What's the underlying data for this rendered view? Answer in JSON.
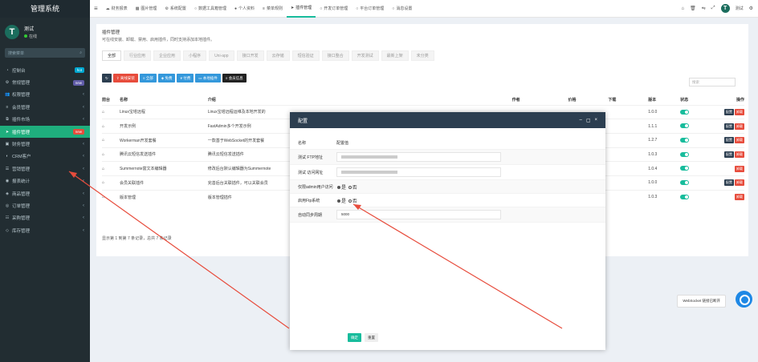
{
  "brand": "管理系统",
  "user": {
    "name": "测试",
    "status": "在线",
    "avatar": "T"
  },
  "search": {
    "placeholder": "搜索菜单",
    "icon": "search-icon"
  },
  "sidebar": [
    {
      "label": "控制台",
      "badge": "hot",
      "badge_color": "#00a7d0",
      "icon": "dashboard-icon"
    },
    {
      "label": "常规管理",
      "badge": "new",
      "badge_color": "#605ca8",
      "icon": "gear-icon"
    },
    {
      "label": "权限管理",
      "icon": "users-icon"
    },
    {
      "label": "会员管理",
      "icon": "user-icon"
    },
    {
      "label": "插件市场",
      "icon": "puzzle-icon"
    },
    {
      "label": "插件管理",
      "badge": "new",
      "badge_color": "#e74c3c",
      "icon": "rocket-icon",
      "active": true
    },
    {
      "label": "财务管理",
      "icon": "money-icon"
    },
    {
      "label": "CRM客户",
      "icon": "crm-icon"
    },
    {
      "label": "营销管理",
      "icon": "bullhorn-icon"
    },
    {
      "label": "报表统计",
      "icon": "chart-icon"
    },
    {
      "label": "商品管理",
      "icon": "box-icon"
    },
    {
      "label": "订单管理",
      "icon": "order-icon"
    },
    {
      "label": "采购管理",
      "icon": "cart-icon"
    },
    {
      "label": "库存管理",
      "icon": "warehouse-icon"
    }
  ],
  "topnav": [
    {
      "label": "财务报表",
      "icon": "cloud-icon"
    },
    {
      "label": "图片管理",
      "icon": "image-icon"
    },
    {
      "label": "系统配置",
      "icon": "cog-icon"
    },
    {
      "label": "数据工具箱管理",
      "icon": "circle-icon"
    },
    {
      "label": "个人资料",
      "icon": "person-icon"
    },
    {
      "label": "菜单规则",
      "icon": "list-icon"
    },
    {
      "label": "插件管理",
      "icon": "rocket-icon",
      "active": true
    },
    {
      "label": "开发订单管理",
      "icon": "circle-icon"
    },
    {
      "label": "平台订单管理",
      "icon": "circle-icon"
    },
    {
      "label": "消息设置",
      "icon": "circle-icon"
    }
  ],
  "topright": {
    "username": "测试",
    "avatar": "T",
    "icons": [
      "home-icon",
      "trash-icon",
      "language-icon",
      "fullscreen-icon",
      "settings-icon"
    ]
  },
  "page": {
    "title": "插件管理",
    "desc": "可在线安装、卸载、禁用、启用插件，同时支持添加本地插件。"
  },
  "tabs": [
    "全部",
    "行业应用",
    "企业应用",
    "小程序",
    "Uni-app",
    "接口开发",
    "云存储",
    "短信验证",
    "接口整合",
    "开发测试",
    "最新上架",
    "未分类"
  ],
  "toolbar": [
    {
      "label": "",
      "icon": "refresh-icon",
      "color": "dark"
    },
    {
      "label": "离线安装",
      "icon": "upload-icon",
      "color": "red"
    },
    {
      "label": "全部",
      "icon": "list-icon",
      "color": "blue"
    },
    {
      "label": "免费",
      "icon": "gift-icon",
      "color": "blue"
    },
    {
      "label": "付费",
      "icon": "yen-icon",
      "color": "blue"
    },
    {
      "label": "本地插件",
      "icon": "laptop-icon",
      "color": "blue"
    },
    {
      "label": "会员信息",
      "icon": "user-icon",
      "color": "blk"
    }
  ],
  "table_search": {
    "placeholder": "搜索"
  },
  "table": {
    "headers": [
      "前台",
      "名称",
      "介绍",
      "作者",
      "价格",
      "下载",
      "版本",
      "状态",
      "操作"
    ],
    "rows": [
      {
        "name": "Linux宝塔远程",
        "intro": "Linux宝塔远程运维及本地开发的",
        "version": "1.0.0",
        "ops": [
          "配置",
          "卸载"
        ]
      },
      {
        "name": "开发示例",
        "intro": "FastAdmin多个开发示例",
        "version": "1.1.1",
        "ops": [
          "配置",
          "卸载"
        ]
      },
      {
        "name": "Workerman开发套餐",
        "intro": "一款基于WebSocket的开发套餐",
        "version": "1.2.7",
        "ops": [
          "配置",
          "卸载"
        ]
      },
      {
        "name": "腾讯云短信发送插件",
        "intro": "腾讯云短信发送插件",
        "version": "1.0.3",
        "ops": [
          "配置",
          "卸载"
        ]
      },
      {
        "name": "Summernote富文本编辑器",
        "intro": "修改后台默认编辑器为Summernote",
        "version": "1.0.4",
        "ops": [
          "卸载"
        ]
      },
      {
        "name": "会员关联插件",
        "intro": "完善后台关联插件，可以关联会员",
        "version": "1.0.0",
        "ops": [
          "配置",
          "卸载"
        ]
      },
      {
        "name": "版本管理",
        "intro": "版本管理插件",
        "version": "1.0.3",
        "ops": [
          "卸载"
        ]
      }
    ]
  },
  "footer": "显示第 1 到第 7 条记录，总共 7 条记录",
  "modal": {
    "title": "配置",
    "col1": "名称",
    "col2": "配置值",
    "rows": [
      {
        "label": "测试 FTP地址",
        "type": "blurred"
      },
      {
        "label": "测试 访问网址",
        "type": "blurred"
      },
      {
        "label": "仅限admin用户访问",
        "type": "radio",
        "opt1": "是",
        "opt2": "否"
      },
      {
        "label": "启用Ftp系统",
        "type": "radio",
        "opt1": "是",
        "opt2": "否"
      },
      {
        "label": "自动同步周期",
        "type": "input",
        "value": "5000"
      }
    ],
    "ok": "确定",
    "reset": "重置"
  },
  "websocket": "WebSocket 链接已断开"
}
